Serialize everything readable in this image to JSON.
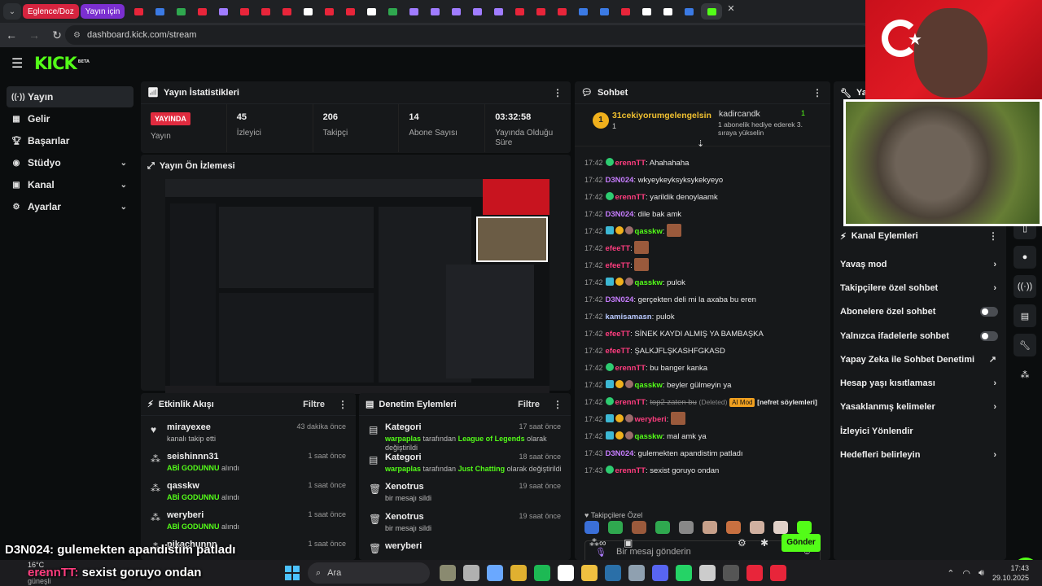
{
  "browser": {
    "pinned_tabs": [
      "Eglence/Doz",
      "Yayın için"
    ],
    "url": "dashboard.kick.com/stream"
  },
  "colors": {
    "accent": "#53fc18",
    "live": "#e02b3f",
    "panel": "#16181a",
    "bg": "#0b0d0e"
  },
  "logo": {
    "text": "KICK",
    "badge": "BETA"
  },
  "sidebar": {
    "items": [
      {
        "label": "Yayın",
        "icon": "broadcast-icon"
      },
      {
        "label": "Gelir",
        "icon": "revenue-icon"
      },
      {
        "label": "Başarılar",
        "icon": "trophy-icon"
      },
      {
        "label": "Stüdyo",
        "icon": "studio-icon"
      },
      {
        "label": "Kanal",
        "icon": "channel-icon"
      },
      {
        "label": "Ayarlar",
        "icon": "gear-icon"
      }
    ]
  },
  "stats": {
    "title": "Yayın İstatistikleri",
    "live_badge": "YAYINDA",
    "status_label": "Yayın",
    "viewers": {
      "value": "45",
      "label": "İzleyici"
    },
    "followers": {
      "value": "206",
      "label": "Takipçi"
    },
    "subs": {
      "value": "14",
      "label": "Abone Sayısı"
    },
    "uptime": {
      "value": "03:32:58",
      "label": "Yayında Olduğu Süre"
    }
  },
  "preview": {
    "title": "Yayın Ön İzlemesi"
  },
  "activity": {
    "title": "Etkinlik Akışı",
    "filter": "Filtre",
    "items": [
      {
        "name": "mirayexee",
        "text": "kanalı takip etti",
        "highlight": "",
        "time": "43 dakika önce"
      },
      {
        "name": "seishinnn31",
        "highlight": "ABİ GODUNNU",
        "text": " alındı",
        "time": "1 saat önce"
      },
      {
        "name": "qasskw",
        "highlight": "ABİ GODUNNU",
        "text": " alındı",
        "time": "1 saat önce"
      },
      {
        "name": "weryberi",
        "highlight": "ABİ GODUNNU",
        "text": " alındı",
        "time": "1 saat önce"
      },
      {
        "name": "pikachunnn",
        "highlight": "",
        "text": "",
        "time": "1 saat önce"
      }
    ]
  },
  "moderation": {
    "title": "Denetim Eylemleri",
    "filter": "Filtre",
    "items": [
      {
        "title": "Kategori",
        "line1_user": "warpaplas",
        "line1_mid": " tarafından ",
        "line1_game": "League of Legends",
        "line1_end": "  olarak",
        "line2": "değiştirildi",
        "time": "17 saat önce"
      },
      {
        "title": "Kategori",
        "line1_user": "warpaplas",
        "line1_mid": " tarafından ",
        "line1_game": "Just Chatting",
        "line1_end": " olarak değiştirildi",
        "line2": "",
        "time": "18 saat önce"
      },
      {
        "title": "Xenotrus",
        "line1_user": "",
        "line1_mid": "bir mesajı sildi",
        "line1_game": "",
        "line1_end": "",
        "line2": "",
        "time": "19 saat önce"
      },
      {
        "title": "Xenotrus",
        "line1_user": "",
        "line1_mid": "bir mesajı sildi",
        "line1_game": "",
        "line1_end": "",
        "line2": "",
        "time": "19 saat önce"
      },
      {
        "title": "weryberi",
        "line1_user": "",
        "line1_mid": "",
        "line1_game": "",
        "line1_end": "",
        "line2": "",
        "time": ""
      }
    ]
  },
  "chat": {
    "title": "Sohbet",
    "pinned_user": "31cekiyorumgelengelsin",
    "pinned_count": "1",
    "gifter": "kadircandk",
    "gifter_count": "1",
    "gift_text": "1 abonelik hediye ederek 3. sıraya yükselin",
    "messages": [
      {
        "time": "17:42",
        "user": "erennTT",
        "color": "#ff3d7f",
        "text": "Ahahahaha"
      },
      {
        "time": "17:42",
        "user": "D3N024",
        "color": "#c77dff",
        "text": "wkyeykeyksyksykekyeyo"
      },
      {
        "time": "17:42",
        "user": "erennTT",
        "color": "#ff3d7f",
        "text": "yarildik denoylaamk"
      },
      {
        "time": "17:42",
        "user": "D3N024",
        "color": "#c77dff",
        "text": "dile bak amk"
      },
      {
        "time": "17:42",
        "user": "qasskw",
        "color": "#53fc18",
        "text": ""
      },
      {
        "time": "17:42",
        "user": "efeeTT",
        "color": "#ff3d7f",
        "text": ""
      },
      {
        "time": "17:42",
        "user": "efeeTT",
        "color": "#ff3d7f",
        "text": ""
      },
      {
        "time": "17:42",
        "user": "qasskw",
        "color": "#53fc18",
        "text": "pulok"
      },
      {
        "time": "17:42",
        "user": "D3N024",
        "color": "#c77dff",
        "text": "gerçekten deli mi la axaba bu eren"
      },
      {
        "time": "17:42",
        "user": "kamisamasn",
        "color": "#b9c9ff",
        "text": "pulok"
      },
      {
        "time": "17:42",
        "user": "efeeTT",
        "color": "#ff3d7f",
        "text": "SİNEK KAYDI ALMIŞ YA BAMBAŞKA"
      },
      {
        "time": "17:42",
        "user": "efeeTT",
        "color": "#ff3d7f",
        "text": "ŞALKJFLŞKASHFGKASD"
      },
      {
        "time": "17:42",
        "user": "erennTT",
        "color": "#ff3d7f",
        "text": "bu banger kanka"
      },
      {
        "time": "17:42",
        "user": "qasskw",
        "color": "#53fc18",
        "text": "beyler gülmeyin ya"
      },
      {
        "time": "17:42",
        "user": "erennTT",
        "color": "#ff3d7f",
        "text": "top2 zaten bu",
        "deleted": "(Deleted)",
        "ai": "AI Mod",
        "reason": "[nefret söylemleri]"
      },
      {
        "time": "17:42",
        "user": "weryberi",
        "color": "#ff3d7f",
        "text": ""
      },
      {
        "time": "17:42",
        "user": "qasskw",
        "color": "#53fc18",
        "text": "mal amk ya"
      },
      {
        "time": "17:43",
        "user": "D3N024",
        "color": "#c77dff",
        "text": "gulemekten apandistim patladı"
      },
      {
        "time": "17:43",
        "user": "erennTT",
        "color": "#ff3d7f",
        "text": "sexist goruyo ondan"
      }
    ],
    "followers_only": "Takipçilere Özel",
    "placeholder": "Bir mesaj gönderin",
    "send": "Gönder"
  },
  "actions": {
    "title_top": "Yayı",
    "title": "Kanal Eylemleri",
    "items": [
      {
        "label": "Yavaş mod",
        "type": "chevron"
      },
      {
        "label": "Takipçilere özel sohbet",
        "type": "chevron"
      },
      {
        "label": "Abonelere özel sohbet",
        "type": "toggle"
      },
      {
        "label": "Yalnızca ifadelerle sohbet",
        "type": "toggle"
      },
      {
        "label": "Yapay Zeka ile Sohbet Denetimi",
        "type": "external"
      },
      {
        "label": "Hesap yaşı kısıtlaması",
        "type": "chevron"
      },
      {
        "label": "Yasaklanmış kelimeler",
        "type": "chevron"
      },
      {
        "label": "İzleyici Yönlendir",
        "type": "none"
      },
      {
        "label": "Hedefleri belirleyin",
        "type": "chevron"
      }
    ]
  },
  "captions": {
    "line1_user": "D3N024:",
    "line1_text": " gulemekten apandistim patladı",
    "line2_user": "erennTT:",
    "line2_text": " sexist goruyo ondan"
  },
  "taskbar": {
    "temp": "16°C",
    "weather": "Kısmen güneşli",
    "search": "Ara",
    "time": "17:43",
    "date": "29.10.2025"
  }
}
